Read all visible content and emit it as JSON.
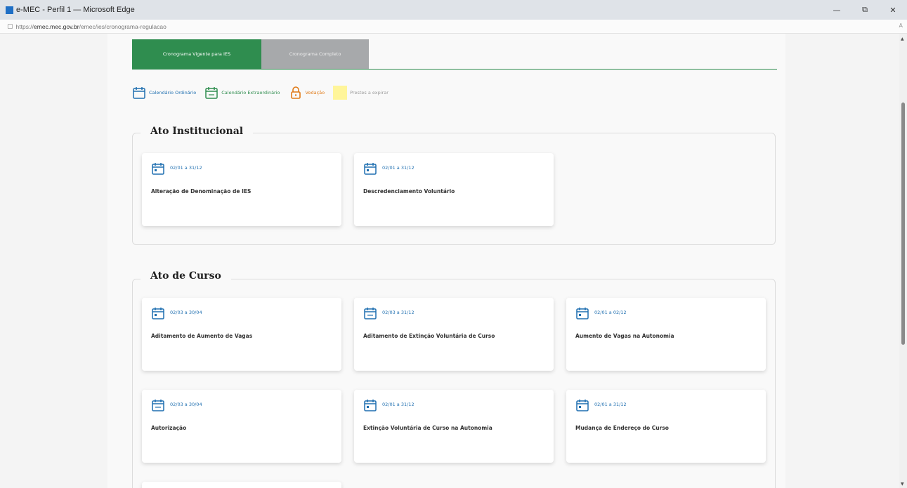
{
  "window": {
    "title": "e-MEC - Perfil 1 — Microsoft Edge",
    "controls": {
      "minimize": "—",
      "restore": "⧉",
      "close": "✕"
    }
  },
  "address": {
    "prefix": "https://",
    "host": "emec.mec.gov.br",
    "path": "/emec/ies/cronograma-regulacao"
  },
  "tabs": [
    {
      "label": "Cronograma Vigente para IES",
      "active": true
    },
    {
      "label": "Cronograma Completo",
      "active": false
    }
  ],
  "legend": {
    "ordinary": "Calendário Ordinário",
    "extraordinary": "Calendário Extraordinário",
    "sealed": "Vedação",
    "expiring": "Prestes a expirar"
  },
  "colors": {
    "green": "#2f8d4f",
    "blue": "#1f6fb0",
    "orange": "#e07a17",
    "yellow": "#fff59a",
    "gray_tab": "#a7a9ab"
  },
  "sections": [
    {
      "title": "Ato Institucional",
      "cards": [
        {
          "date": "02/01 a 31/12",
          "title": "Alteração de Denominação de IES",
          "calendar": "ordinary"
        },
        {
          "date": "02/01 a 31/12",
          "title": "Descredenciamento Voluntário",
          "calendar": "ordinary"
        }
      ]
    },
    {
      "title": "Ato de Curso",
      "cards": [
        {
          "date": "02/03 a 30/04",
          "title": "Aditamento de Aumento de Vagas",
          "calendar": "ordinary"
        },
        {
          "date": "02/03 a 31/12",
          "title": "Aditamento de Extinção Voluntária de Curso",
          "calendar": "extraordinary"
        },
        {
          "date": "02/01 a 02/12",
          "title": "Aumento de Vagas na Autonomia",
          "calendar": "ordinary"
        },
        {
          "date": "02/03 a 30/04",
          "title": "Autorização",
          "calendar": "extraordinary"
        },
        {
          "date": "02/01 a 31/12",
          "title": "Extinção Voluntária de Curso na Autonomia",
          "calendar": "ordinary"
        },
        {
          "date": "02/01 a 31/12",
          "title": "Mudança de Endereço do Curso",
          "calendar": "ordinary"
        }
      ]
    }
  ],
  "icons": {
    "calendar": "calendar-icon",
    "calendar_extra": "calendar-extra-icon",
    "lock": "lock-icon"
  }
}
